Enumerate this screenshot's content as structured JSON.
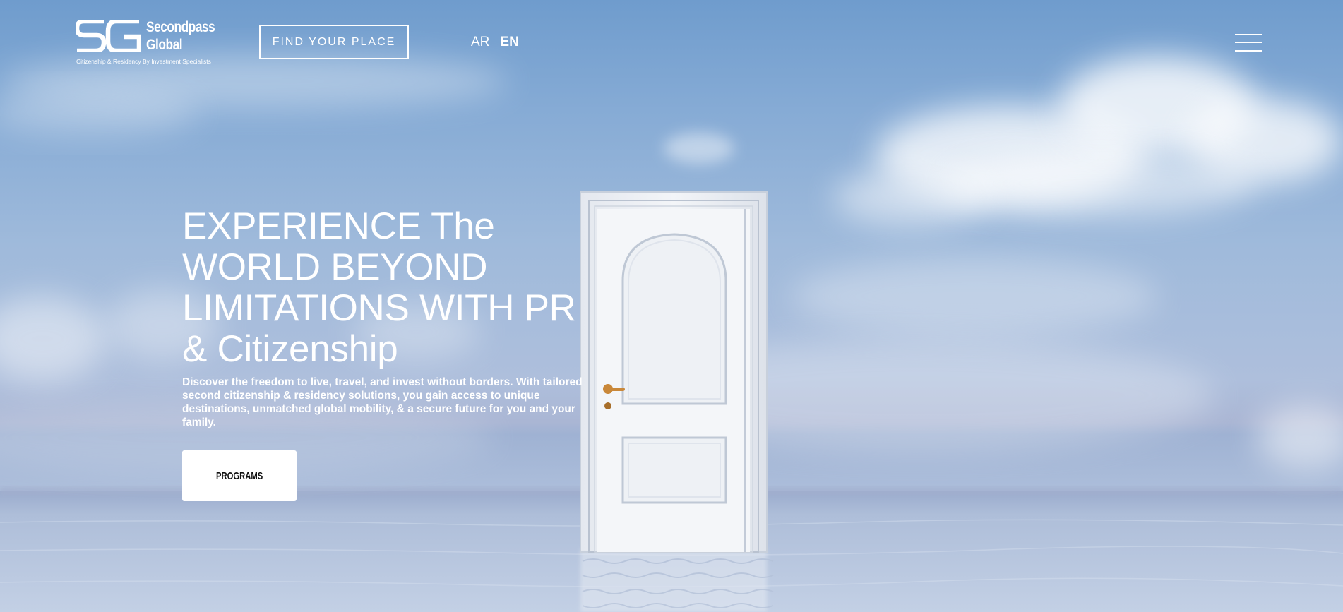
{
  "header": {
    "logo": {
      "monogram": "SG",
      "name_line1": "Secondpass",
      "name_line2": "Global",
      "tagline": "Citizenship & Residency By Investment Specialists"
    },
    "cta_label": "FIND YOUR PLACE",
    "languages": [
      {
        "code": "AR",
        "active": false
      },
      {
        "code": "EN",
        "active": true
      }
    ],
    "menu_icon": "hamburger-menu-icon"
  },
  "hero": {
    "headline": "EXPERIENCE The WORLD BEYOND LIMITATIONS WITH PR & Citizenship",
    "description": "Discover the freedom to live, travel, and invest without borders. With tailored second citizenship & residency solutions, you gain access to unique destinations, unmatched global mobility, & a secure future for you and your family.",
    "button_label": "PROGRAMS",
    "background": "white-door-standing-in-calm-sea-under-blue-cloudy-sky"
  },
  "colors": {
    "sky_top": "#6f9ccd",
    "sky_mid": "#9fbadb",
    "horizon": "#aab6d4",
    "sea": "#bfcde4",
    "door": "#eef0f4",
    "door_handle": "#c9883a",
    "text": "#ffffff",
    "button_bg": "#ffffff",
    "button_text": "#111111"
  }
}
